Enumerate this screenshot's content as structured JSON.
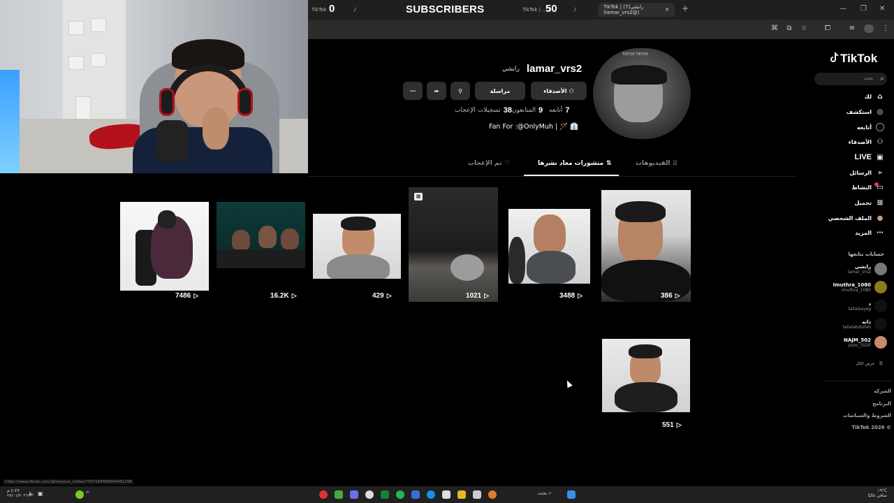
{
  "stream": {
    "counter_left": "0",
    "counter_right": "50",
    "subscribers_label": "SUBSCRIBERS"
  },
  "browser": {
    "tabs": [
      {
        "label": "TikTok"
      },
      {
        "label": "TikTok | ...الـ"
      },
      {
        "label": "TikTok | (7)رانشي (lamar_vrs2@)"
      }
    ],
    "new_tab": "+",
    "status_url": "https://www.tiktok.com/@itsoyous_/video/7597164568904961298"
  },
  "sidebar": {
    "logo": "TikTok",
    "search_placeholder": "بحث",
    "nav": [
      {
        "label": "لك",
        "icon": "home-icon"
      },
      {
        "label": "استكشف",
        "icon": "compass-icon"
      },
      {
        "label": "أتابعه",
        "icon": "following-icon"
      },
      {
        "label": "الأصدقاء",
        "icon": "friends-icon"
      },
      {
        "label": "LIVE",
        "icon": "live-icon"
      },
      {
        "label": "الرسائل",
        "icon": "messages-icon"
      },
      {
        "label": "النشاط",
        "icon": "activity-icon"
      },
      {
        "label": "تحميل",
        "icon": "upload-icon"
      },
      {
        "label": "الملف الشخصي",
        "icon": "profile-icon"
      },
      {
        "label": "المزيد",
        "icon": "more-icon"
      }
    ],
    "following_heading": "حسابات تتابعها",
    "following": [
      {
        "name": "رانشي",
        "handle": "lamar_vrs2"
      },
      {
        "name": "Imuthra_1080",
        "handle": "imuthra_1080"
      },
      {
        "name": "د",
        "handle": "tallalsayeg"
      },
      {
        "name": "ذانه",
        "handle": "tallalabdullah"
      },
      {
        "name": "NAJM_502",
        "handle": "jojoo_5020"
      }
    ],
    "see_all": "عرض الكل",
    "footer": [
      "الشركة",
      "البرنامج",
      "الشروط والسياسات",
      "TikTok 2026 ©"
    ]
  },
  "profile": {
    "username": "lamar_vrs2",
    "nickname": "رانشي",
    "avatar_tag": "TIKTOK TIKTOK",
    "buttons": {
      "friends": "الأصدقاء",
      "message": "مراسلة",
      "more": "⋯"
    },
    "stats": [
      {
        "value": "7",
        "label": "أتابعه"
      },
      {
        "value": "9",
        "label": "المتابعون"
      },
      {
        "value": "38",
        "label": "تسجيلات الإعجاب"
      }
    ],
    "bio": "Fan For :@OnlyMuh | 🪄 👔"
  },
  "tabs": [
    {
      "label": "الفيديوهات",
      "icon": "grid-icon",
      "active": false
    },
    {
      "label": "منشورات معاد نشرها",
      "icon": "repost-icon",
      "active": true
    },
    {
      "label": "تم الإعجاب",
      "icon": "heart-icon",
      "active": false
    }
  ],
  "videos": [
    {
      "views": "386"
    },
    {
      "views": "3488"
    },
    {
      "views": "1021"
    },
    {
      "views": "429"
    },
    {
      "views": "16.2K"
    },
    {
      "views": "7486"
    },
    {
      "views": "551"
    }
  ],
  "taskbar": {
    "clock": "٤:٤٩ م\n٢٧/٠١/٢٠٢٦",
    "weather": "١٩°C\nصافي غالبًا",
    "search": "بحث"
  }
}
